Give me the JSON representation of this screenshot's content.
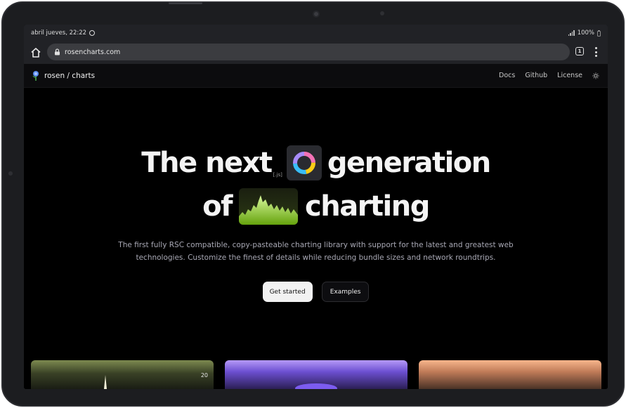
{
  "status_bar": {
    "datetime": "abril jueves, 22:22",
    "battery": "100%"
  },
  "browser": {
    "url": "rosencharts.com",
    "tab_count": "1"
  },
  "site_nav": {
    "brand": "rosen / charts",
    "links": [
      "Docs",
      "Github",
      "License"
    ]
  },
  "hero": {
    "line1_left": "The next",
    "js_tag": "[.js]",
    "line1_right": "generation",
    "line2_left": "of",
    "line2_right": "charting",
    "subtitle_line1": "The first fully RSC compatible, copy-pasteable charting library with support for the latest and greatest web",
    "subtitle_line2": "technologies. Customize the finest of details while reducing bundle sizes and network roundtrips.",
    "primary_button": "Get started",
    "secondary_button": "Examples"
  },
  "preview_cards": [
    {
      "value": "20"
    },
    {},
    {}
  ],
  "colors": {
    "background": "#000000",
    "accent_green": "#a3e635",
    "button_primary_bg": "#f2f2f2"
  }
}
